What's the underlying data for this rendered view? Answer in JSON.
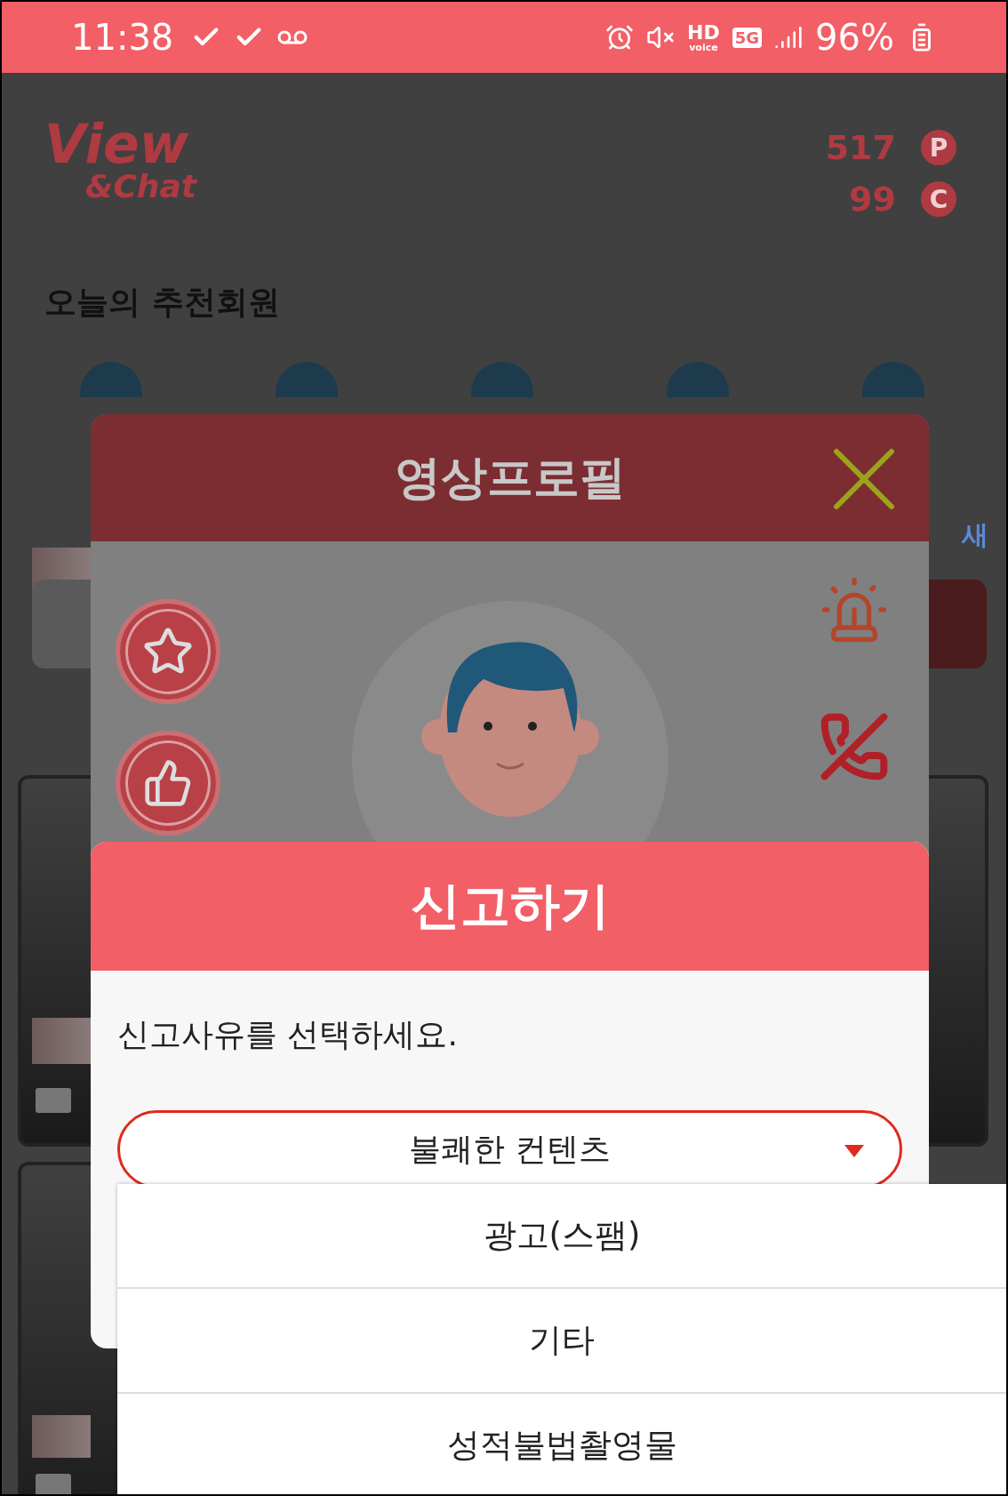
{
  "status_bar": {
    "time": "11:38",
    "hd": "HD",
    "hd_sub": "voice",
    "network": "5G",
    "battery": "96%"
  },
  "header": {
    "logo_top": "View",
    "logo_bottom": "&Chat",
    "balances": [
      {
        "amount": "517",
        "unit": "P"
      },
      {
        "amount": "99",
        "unit": "C"
      }
    ]
  },
  "section_title": "오늘의 추천회원",
  "side_link": "새",
  "profile_modal": {
    "title": "영상프로필"
  },
  "report_modal": {
    "title": "신고하기",
    "prompt": "신고사유를 선택하세요.",
    "select": {
      "value": "불쾌한 컨텐츠",
      "expanded": true
    },
    "options": [
      "광고(스팸)",
      "기타",
      "성적불법촬영물"
    ]
  }
}
